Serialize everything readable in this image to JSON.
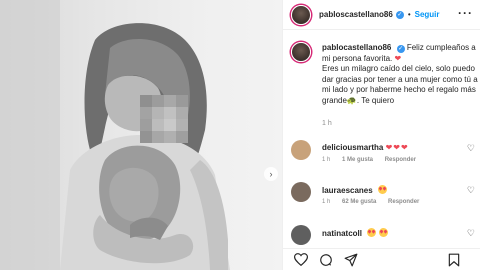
{
  "post": {
    "username": "pabloscastellano86",
    "follow_label": "Seguir",
    "separator": "•",
    "caption": {
      "username": "pablocastellano86",
      "line1": "Feliz cumpleaños a mi persona favorita.",
      "line2": "Eres un milagro caído del cielo, solo puedo dar gracias por tener a una mujer como tú a mi lado y por haberme hecho el regalo más grande",
      "ending": "Te quiero",
      "heart_emoji": "❤",
      "turtle_emoji": "🐢",
      "time": "1 h"
    },
    "comments": [
      {
        "username": "deliciousmartha",
        "text": "❤❤❤",
        "time": "1 h",
        "likes": "1 Me gusta",
        "reply": "Responder",
        "avatar_color": "#c8a27a"
      },
      {
        "username": "lauraescanes",
        "text": "",
        "time": "1 h",
        "likes": "62 Me gusta",
        "reply": "Responder",
        "avatar_color": "#7a6a5e"
      },
      {
        "username": "natinatcoll",
        "text": "",
        "time": "",
        "likes": "",
        "reply": "",
        "avatar_color": "#5f5f5f"
      }
    ]
  },
  "icons": {
    "verified": "verified-badge-icon",
    "more": "more-options-icon",
    "heart": "heart-icon",
    "comment": "comment-icon",
    "share": "share-icon",
    "save": "bookmark-icon",
    "next": "chevron-right-icon"
  },
  "colors": {
    "accent": "#0095f6",
    "verified": "#3897f0",
    "heart": "#ed4956",
    "muted": "#8e8e8e"
  }
}
